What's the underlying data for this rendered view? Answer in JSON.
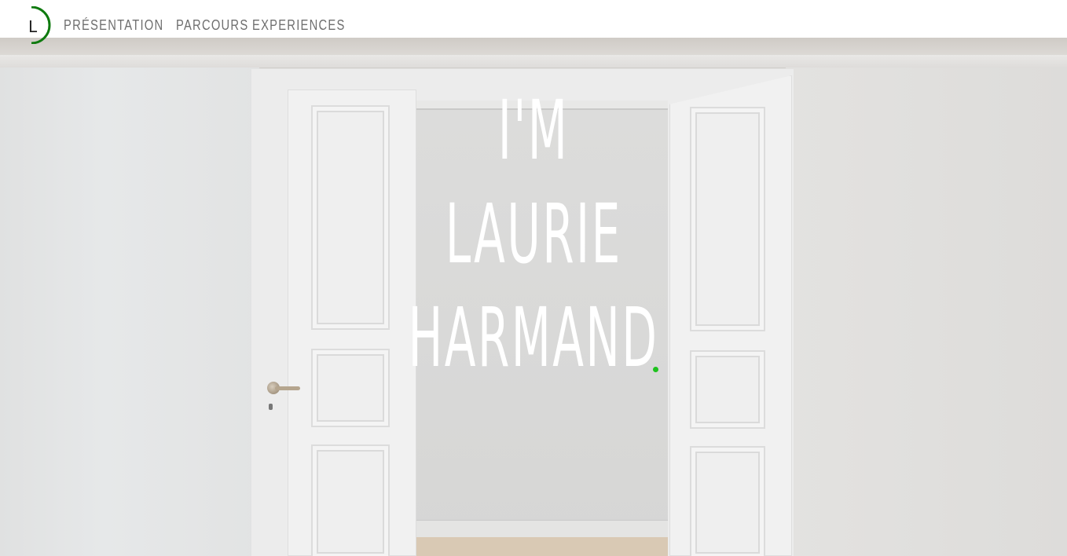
{
  "logo": {
    "letter": "L",
    "accent_color": "#0f7a0f",
    "icon": "logo-arc-icon"
  },
  "nav": {
    "items": [
      {
        "label": "PRÉSENTATION"
      },
      {
        "label": "PARCOURS"
      },
      {
        "label": "EXPERIENCES"
      }
    ]
  },
  "hero": {
    "lines": [
      "I'M",
      "LAURIE",
      "HARMAND"
    ],
    "dot_color": "#1ec21e",
    "text_color": "#ffffff"
  }
}
